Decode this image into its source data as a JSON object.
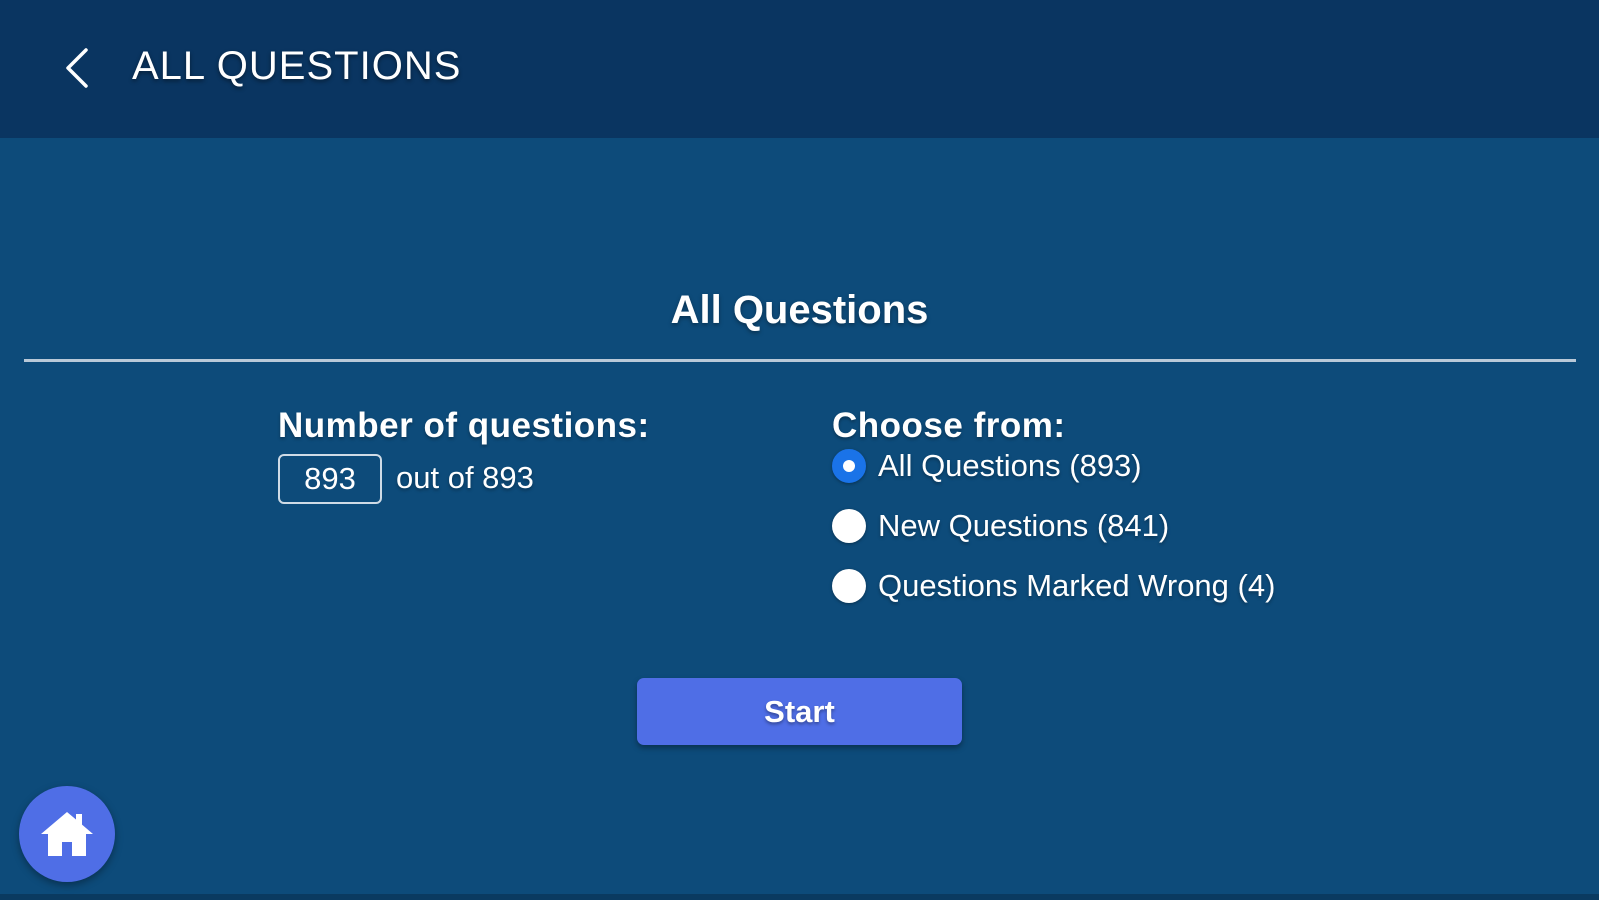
{
  "header": {
    "title": "ALL QUESTIONS",
    "back_icon": "chevron-left-icon"
  },
  "main": {
    "section_title": "All Questions",
    "number_of_questions": {
      "label": "Number of questions:",
      "value": "893",
      "suffix": "out of 893"
    },
    "choose_from": {
      "label": "Choose from:",
      "options": [
        {
          "label": "All Questions (893)",
          "selected": true
        },
        {
          "label": "New Questions (841)",
          "selected": false
        },
        {
          "label": "Questions Marked Wrong (4)",
          "selected": false
        }
      ]
    },
    "start_label": "Start"
  },
  "home_icon": "home-icon",
  "colors": {
    "header_bg": "#0a3561",
    "main_bg": "#0d4b7a",
    "accent": "#4f6ee6",
    "radio_selected": "#1a73e8"
  }
}
